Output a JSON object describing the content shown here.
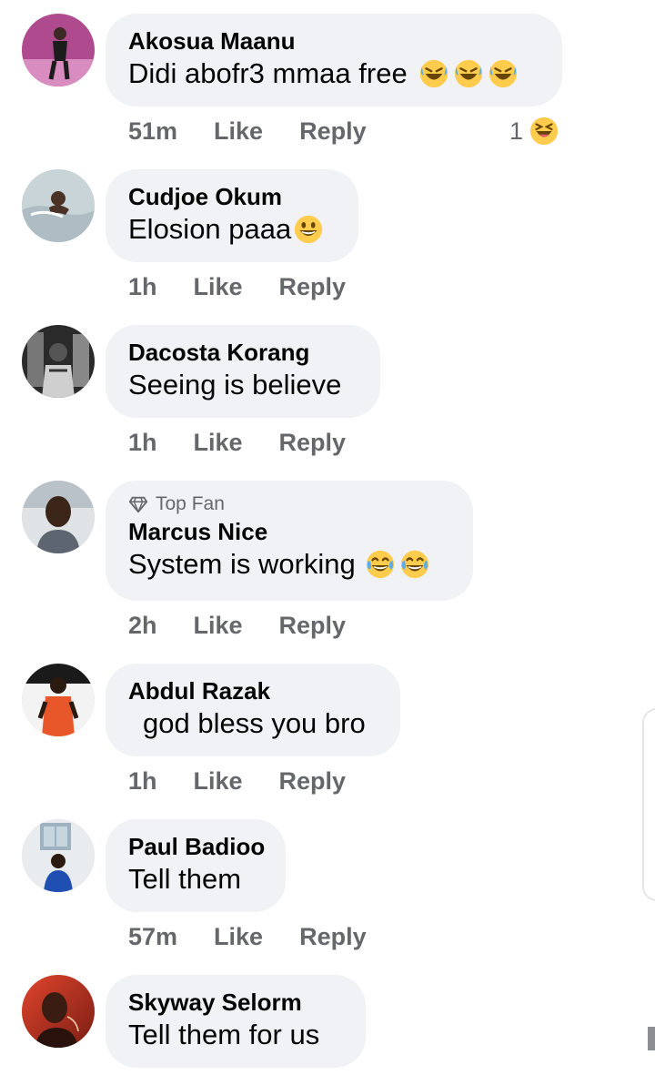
{
  "comments": [
    {
      "author": "Akosua Maanu",
      "text": "Didi abofr3 mmaa free",
      "emojis": [
        "rolling-laughing-icon",
        "rolling-laughing-icon",
        "rolling-laughing-icon"
      ],
      "time": "51m",
      "like_label": "Like",
      "reply_label": "Reply",
      "reaction_count": "1",
      "reaction_icon": "haha-reaction-icon"
    },
    {
      "author": "Cudjoe Okum",
      "text": "Elosion paaa",
      "emojis": [
        "grinning-face-icon"
      ],
      "time": "1h",
      "like_label": "Like",
      "reply_label": "Reply"
    },
    {
      "author": "Dacosta Korang",
      "text": "Seeing is believe",
      "emojis": [],
      "time": "1h",
      "like_label": "Like",
      "reply_label": "Reply"
    },
    {
      "badge": "Top Fan",
      "author": "Marcus Nice",
      "text": "System is working",
      "emojis": [
        "tears-of-joy-icon",
        "tears-of-joy-icon"
      ],
      "time": "2h",
      "like_label": "Like",
      "reply_label": "Reply"
    },
    {
      "author": "Abdul Razak",
      "text": "god bless you bro",
      "emojis": [],
      "time": "1h",
      "like_label": "Like",
      "reply_label": "Reply"
    },
    {
      "author": "Paul Badioo",
      "text": "Tell them",
      "emojis": [],
      "time": "57m",
      "like_label": "Like",
      "reply_label": "Reply"
    },
    {
      "author": "Skyway Selorm",
      "text": "Tell them for us",
      "emojis": []
    }
  ],
  "colors": {
    "bubble": "#f0f2f5",
    "meta_text": "#65676b",
    "emoji_yellow": "#ffcc4d"
  }
}
